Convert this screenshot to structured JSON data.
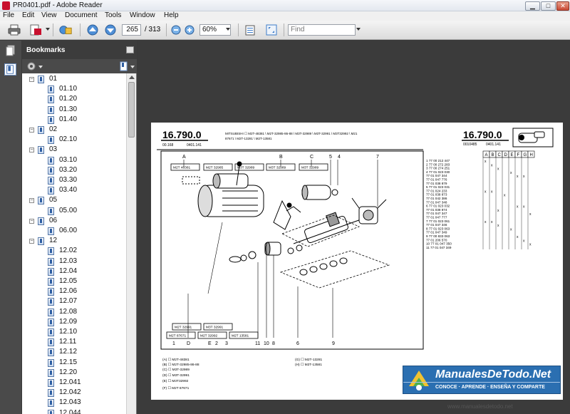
{
  "window": {
    "title": "PR0401.pdf - Adobe Reader",
    "min_glyph": "▁",
    "max_glyph": "□",
    "close_glyph": "✕"
  },
  "menu": [
    "File",
    "Edit",
    "View",
    "Document",
    "Tools",
    "Window",
    "Help"
  ],
  "toolbar": {
    "page_current": "265",
    "page_total": "/ 313",
    "zoom": "60%",
    "find_placeholder": "Find",
    "icons": [
      "print-icon",
      "create-pdf-icon",
      "collaborate-icon",
      "page-up-icon",
      "page-down-icon",
      "zoom-out-icon",
      "zoom-in-icon",
      "fit-width-icon",
      "fullscreen-icon"
    ]
  },
  "panel": {
    "title": "Bookmarks",
    "options_icon": "gear-icon",
    "new_bookmark_icon": "bookmark-add-icon"
  },
  "bookmarks": [
    {
      "label": "01",
      "level": 0,
      "expanded": true
    },
    {
      "label": "01.10",
      "level": 1
    },
    {
      "label": "01.20",
      "level": 1
    },
    {
      "label": "01.30",
      "level": 1
    },
    {
      "label": "01.40",
      "level": 1
    },
    {
      "label": "02",
      "level": 0,
      "expanded": true
    },
    {
      "label": "02.10",
      "level": 1
    },
    {
      "label": "03",
      "level": 0,
      "expanded": true
    },
    {
      "label": "03.10",
      "level": 1
    },
    {
      "label": "03.20",
      "level": 1
    },
    {
      "label": "03.30",
      "level": 1
    },
    {
      "label": "03.40",
      "level": 1
    },
    {
      "label": "05",
      "level": 0,
      "expanded": true
    },
    {
      "label": "05.00",
      "level": 1
    },
    {
      "label": "06",
      "level": 0,
      "expanded": true
    },
    {
      "label": "06.00",
      "level": 1
    },
    {
      "label": "12",
      "level": 0,
      "expanded": true
    },
    {
      "label": "12.02",
      "level": 1
    },
    {
      "label": "12.03",
      "level": 1
    },
    {
      "label": "12.04",
      "level": 1
    },
    {
      "label": "12.05",
      "level": 1
    },
    {
      "label": "12.06",
      "level": 1
    },
    {
      "label": "12.07",
      "level": 1
    },
    {
      "label": "12.08",
      "level": 1
    },
    {
      "label": "12.09",
      "level": 1
    },
    {
      "label": "12.10",
      "level": 1
    },
    {
      "label": "12.11",
      "level": 1
    },
    {
      "label": "12.12",
      "level": 1
    },
    {
      "label": "12.15",
      "level": 1
    },
    {
      "label": "12.20",
      "level": 1
    },
    {
      "label": "12.041",
      "level": 1
    },
    {
      "label": "12.042",
      "level": 1
    },
    {
      "label": "12.043",
      "level": 1
    },
    {
      "label": "12.044",
      "level": 1
    }
  ],
  "document": {
    "code_left": "16.790.0",
    "code_right": "16.790.0",
    "sub_left": "00.168",
    "sub_left2": "0401.141",
    "sub_right": "0010485",
    "sub_right2": "0401.141",
    "header_text": "MITSUBISHI  ☐ M2T-48381  \\ M2T-32985-86-88  \\ M3T-32989  \\ M3T-32991  \\ M3T32992  \\ M21",
    "header_text2": "87671  \\ M2T-13281  \\ M2T-13581",
    "columns": [
      "A",
      "B",
      "C",
      "D",
      "E",
      "F",
      "G",
      "H"
    ],
    "callouts_top": [
      "A",
      "B",
      "C",
      "5",
      "4",
      "7"
    ],
    "callouts_bottom": [
      "1",
      "D",
      "E",
      "2",
      "3",
      "11",
      "10",
      "8",
      "6",
      "9"
    ],
    "boxes_top": [
      "M2T 48381",
      "M2T 32985",
      "M3T 32989",
      "M3T 32989",
      "M3T 32989"
    ],
    "boxes_bottom": [
      "M2T 32991",
      "M3T 32991",
      "M2T 87671",
      "M2T 32992",
      "M2T 13581"
    ],
    "parts": [
      "1  77 00 212 447",
      "2  77 00 272 283",
      "3  77 00 274 251",
      "4  77 01 023 030",
      "   77 01 047 344",
      "   77 01 047 776",
      "   77 01 038 879",
      "5  77 01 023 031",
      "   77 01 024 233",
      "   77 01 038 873",
      "   77 01 042 386",
      "   77 01 047 348",
      "6  77 01 023 032",
      "   77 01 038 874",
      "   77 01 047 347",
      "   77 01 047 777",
      "7  77 01 023 061",
      "   77 01 047 346",
      "8  77 01 023 063",
      "   77 01 047 349",
      "9  77 00 833 063",
      "   77 01 206 570",
      "10 77 01 047 350",
      "11 77 01 047 349"
    ],
    "legend": [
      "(A) ☐ M2T-48381",
      "(B) ☐ M2T-32985-86-88",
      "(C) ☐ M3T-32989",
      "(D) ☐ M3T-32991",
      "(E) ☐ M3T32992",
      "(F) ☐ M2T 87671",
      "(G) ☐ M2T-13281",
      "(H) ☐ M2T-13581"
    ]
  },
  "watermark": {
    "title": "ManualesDeTodo.Net",
    "subtitle": "CONOCE · APRENDE · ENSEÑA Y COMPARTE",
    "url": "www.manualesdetodo.net"
  }
}
